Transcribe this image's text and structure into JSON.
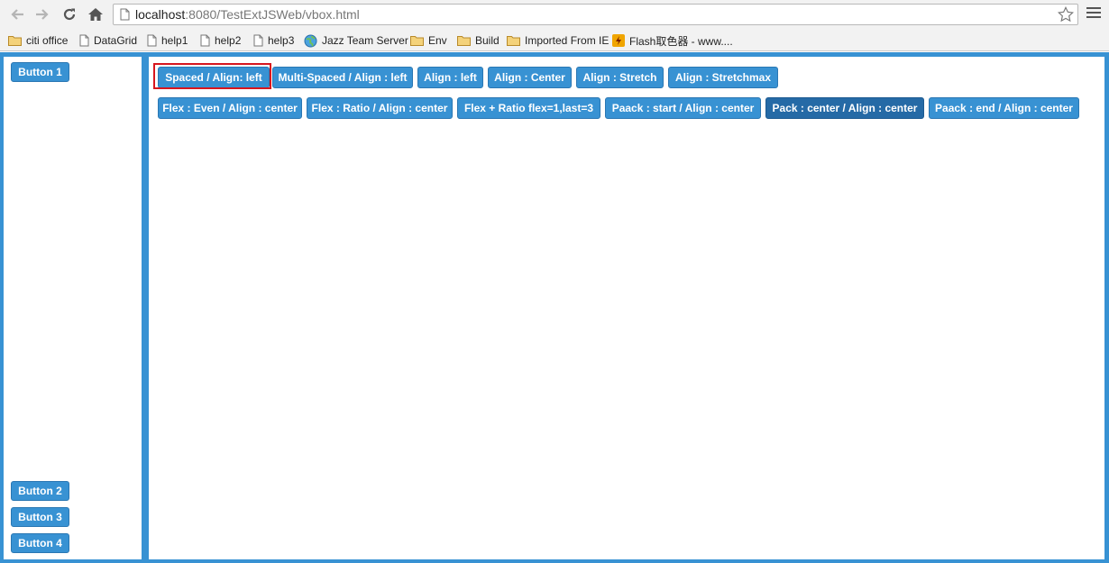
{
  "browser": {
    "url_host": "localhost",
    "url_rest": ":8080/TestExtJSWeb/vbox.html",
    "bookmarks": [
      {
        "label": "citi office",
        "icon": "folder-icon"
      },
      {
        "label": "DataGrid",
        "icon": "page-icon"
      },
      {
        "label": "help1",
        "icon": "page-icon"
      },
      {
        "label": "help2",
        "icon": "page-icon"
      },
      {
        "label": "help3",
        "icon": "page-icon"
      },
      {
        "label": "Jazz Team Server",
        "icon": "globe-icon"
      },
      {
        "label": "Env",
        "icon": "folder-icon"
      },
      {
        "label": "Build",
        "icon": "folder-icon"
      },
      {
        "label": "Imported From IE",
        "icon": "folder-icon"
      },
      {
        "label": "Flash取色器 - www....",
        "icon": "flash-icon"
      }
    ]
  },
  "west": {
    "buttons": [
      "Button 1",
      "Button 2",
      "Button 3",
      "Button 4"
    ]
  },
  "center": {
    "row1": [
      "Spaced / Align: left",
      "Multi-Spaced / Align : left",
      "Align : left",
      "Align : Center",
      "Align : Stretch",
      "Align : Stretchmax"
    ],
    "row2": [
      "Flex : Even / Align : center",
      "Flex : Ratio / Align : center",
      "Flex + Ratio flex=1,last=3",
      "Paack : start / Align : center",
      "Pack : center / Align : center",
      "Paack : end / Align : center"
    ],
    "pressed_button": "Pack : center / Align : center",
    "focused_button": "Spaced / Align: left"
  },
  "colors": {
    "panel_border": "#3892d3",
    "button": "#3892d3",
    "button_pressed": "#256aa6",
    "focus_ring": "#d7161e"
  }
}
